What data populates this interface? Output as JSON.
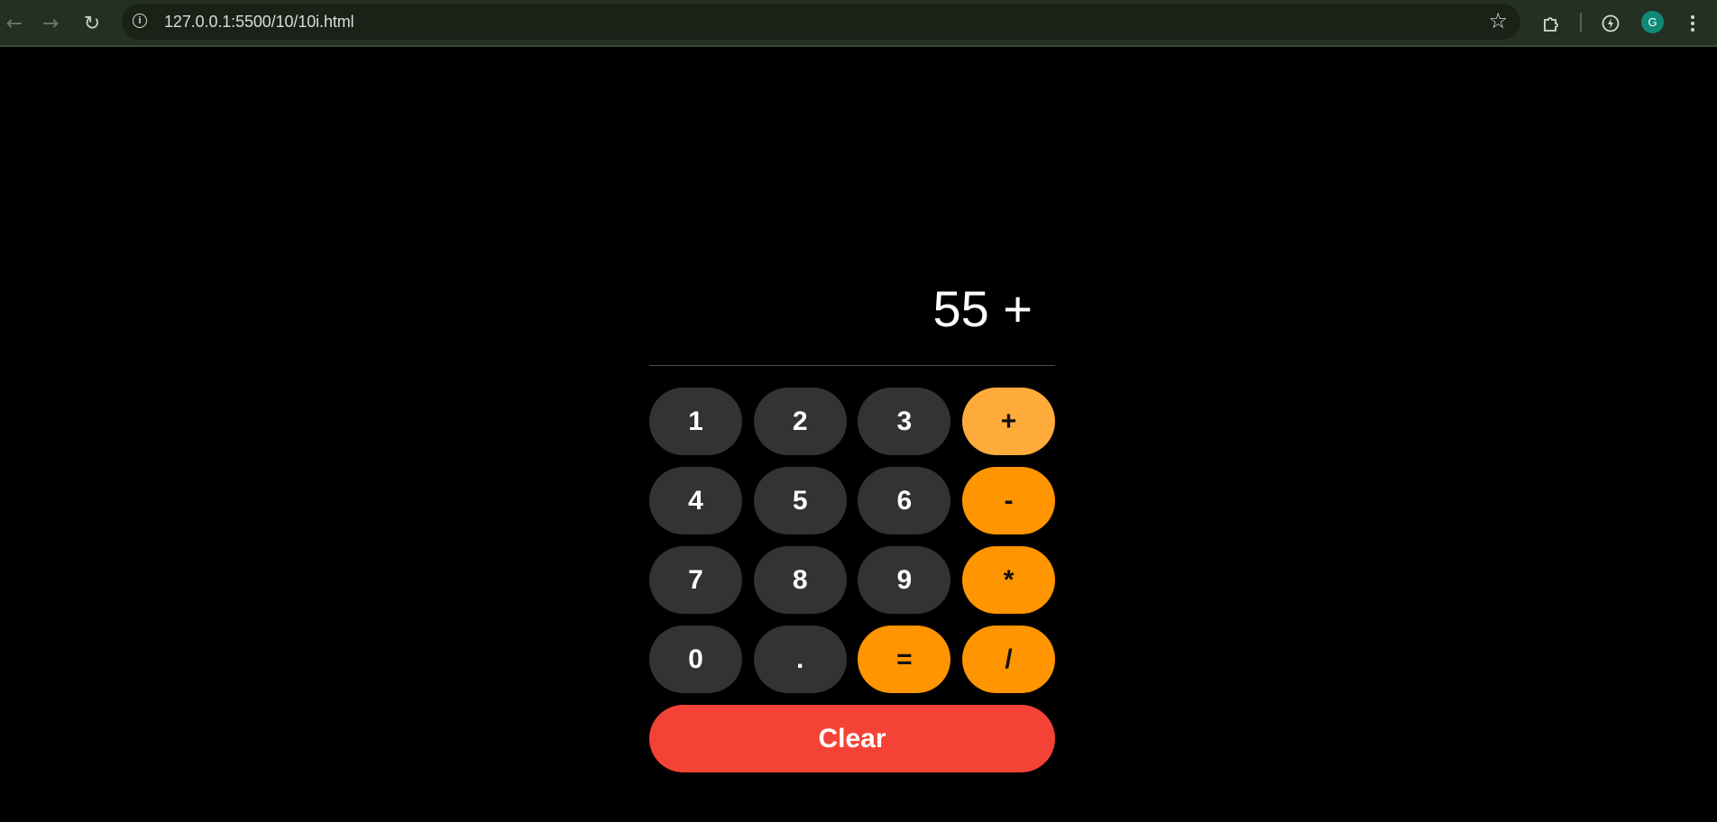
{
  "browser": {
    "url": "127.0.0.1:5500/10/10i.html",
    "avatar_letter": "G",
    "icons": {
      "back": "arrow-left-icon",
      "forward": "arrow-right-icon",
      "reload": "reload-icon",
      "site_info": "info-icon",
      "bookmark": "star-icon",
      "extensions": "puzzle-icon",
      "performance": "lightning-icon",
      "menu": "kebab-menu-icon"
    }
  },
  "calculator": {
    "display": "55 +",
    "keys": [
      {
        "label": "1",
        "kind": "digit"
      },
      {
        "label": "2",
        "kind": "digit"
      },
      {
        "label": "3",
        "kind": "digit"
      },
      {
        "label": "+",
        "kind": "operator"
      },
      {
        "label": "4",
        "kind": "digit"
      },
      {
        "label": "5",
        "kind": "digit"
      },
      {
        "label": "6",
        "kind": "digit"
      },
      {
        "label": "-",
        "kind": "operator"
      },
      {
        "label": "7",
        "kind": "digit"
      },
      {
        "label": "8",
        "kind": "digit"
      },
      {
        "label": "9",
        "kind": "digit"
      },
      {
        "label": "*",
        "kind": "operator"
      },
      {
        "label": "0",
        "kind": "digit"
      },
      {
        "label": ".",
        "kind": "digit"
      },
      {
        "label": "=",
        "kind": "operator"
      },
      {
        "label": "/",
        "kind": "operator"
      }
    ],
    "clear_label": "Clear",
    "colors": {
      "digit_key": "#333333",
      "operator_key": "#ff9500",
      "operator_key_active": "#ffab3b",
      "clear_key": "#f44336",
      "background": "#000000"
    }
  }
}
